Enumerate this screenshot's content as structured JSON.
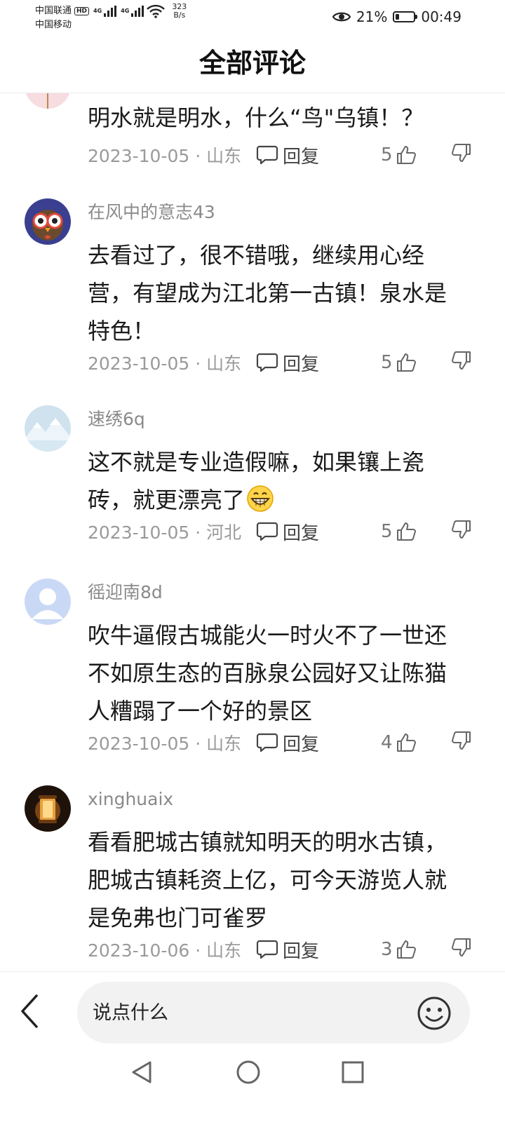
{
  "status_bar": {
    "carrier1": "中国联通",
    "carrier2": "中国移动",
    "hd": "HD",
    "net1": "4G",
    "net2": "4G",
    "speed_value": "323",
    "speed_unit": "B/s",
    "battery": "21%",
    "battery_level": 0.21,
    "time": "00:49",
    "icons": [
      "eye-icon",
      "battery-icon",
      "wifi-icon",
      "signal-icon"
    ]
  },
  "header": {
    "title": "全部评论"
  },
  "comments": [
    {
      "user": "",
      "text": "明水就是明水，什么“鸟\"乌镇！？",
      "date": "2023-10-05",
      "location": "山东",
      "reply_label": "回复",
      "likes": "5"
    },
    {
      "user": "在风中的意志43",
      "text": "去看过了，很不错哦，继续用心经营，有望成为江北第一古镇！泉水是特色！",
      "date": "2023-10-05",
      "location": "山东",
      "reply_label": "回复",
      "likes": "5"
    },
    {
      "user": "速绣6q",
      "text": "这不就是专业造假嘛，如果镶上瓷砖，就更漂亮了",
      "emoji": "grinning-face-emoji",
      "date": "2023-10-05",
      "location": "河北",
      "reply_label": "回复",
      "likes": "5"
    },
    {
      "user": "徭迎南8d",
      "text": "吹牛逼假古城能火一时火不了一世还不如原生态的百脉泉公园好又让陈猫人糟蹋了一个好的景区",
      "date": "2023-10-05",
      "location": "山东",
      "reply_label": "回复",
      "likes": "4"
    },
    {
      "user": "xinghuaix",
      "text": "看看肥城古镇就知明天的明水古镇，肥城古镇耗资上亿，可今天游览人就是免弗也门可雀罗",
      "date": "2023-10-06",
      "location": "山东",
      "reply_label": "回复",
      "likes": "3"
    }
  ],
  "separator": " · ",
  "input": {
    "placeholder": "说点什么"
  },
  "colors": {
    "meta": "#9a9a9a",
    "username": "#8a8a8a",
    "input_bg": "#f2f2f2"
  }
}
